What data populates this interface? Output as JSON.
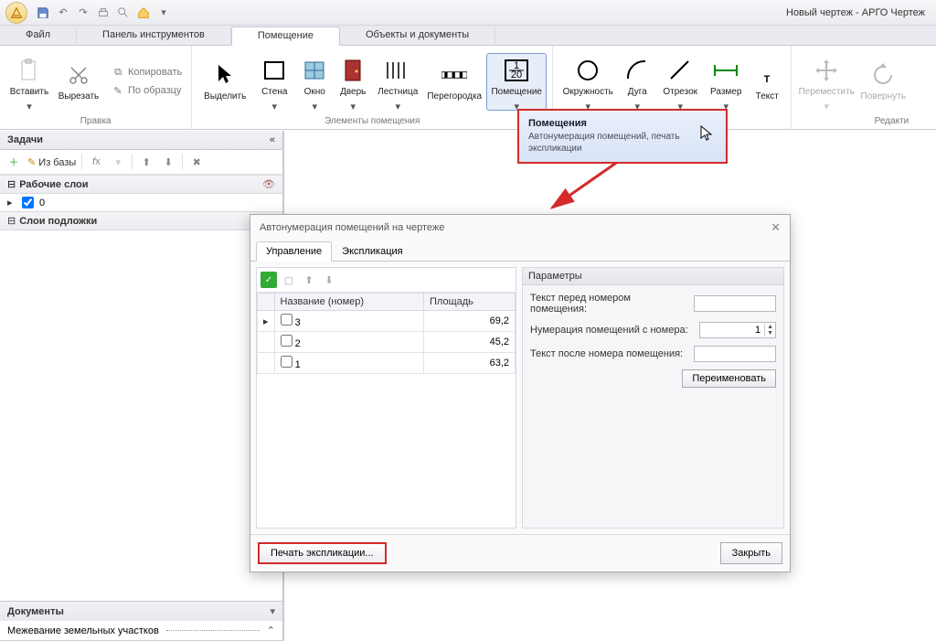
{
  "title": "Новый чертеж - АРГО Чертеж",
  "menutabs": [
    "Файл",
    "Панель инструментов",
    "Помещение",
    "Объекты и документы"
  ],
  "menutab_active": 2,
  "ribbon": {
    "edit_group": {
      "paste": "Вставить",
      "cut": "Вырезать",
      "copy": "Копировать",
      "format": "По образцу",
      "label": "Правка"
    },
    "elements_group": {
      "select": "Выделить",
      "wall": "Стена",
      "window": "Окно",
      "door": "Дверь",
      "stairs": "Лестница",
      "partition": "Перегородка",
      "room": "Помещение",
      "label": "Элементы помещения"
    },
    "draw_group": {
      "circle": "Окружность",
      "arc": "Дуга",
      "segment": "Отрезок",
      "size": "Размер",
      "text": "Текст"
    },
    "transform_group": {
      "move": "Переместить",
      "rotate": "Повернуть",
      "label": "Редакти"
    }
  },
  "tooltip": {
    "title": "Помещения",
    "sub": "Автонумерация помещений, печать экспликации"
  },
  "leftpane": {
    "title": "Задачи",
    "from_db": "Из базы",
    "section_layers": "Рабочие слои",
    "layer_value": "0",
    "section_sublayers": "Слои подложки",
    "docs_title": "Документы",
    "docs_item": "Межевание земельных участков"
  },
  "dialog": {
    "title": "Автонумерация помещений на чертеже",
    "tabs": [
      "Управление",
      "Экспликация"
    ],
    "tab_active": 0,
    "col_name": "Название (номер)",
    "col_area": "Площадь",
    "rows": [
      {
        "name": "3",
        "area": "69,2"
      },
      {
        "name": "2",
        "area": "45,2"
      },
      {
        "name": "1",
        "area": "63,2"
      }
    ],
    "params_title": "Параметры",
    "p_prefix": "Текст перед номером помещения:",
    "p_start": "Нумерация помещений с номера:",
    "p_start_val": "1",
    "p_suffix": "Текст после номера помещения:",
    "rename": "Переименовать",
    "print": "Печать экспликации...",
    "close": "Закрыть"
  }
}
